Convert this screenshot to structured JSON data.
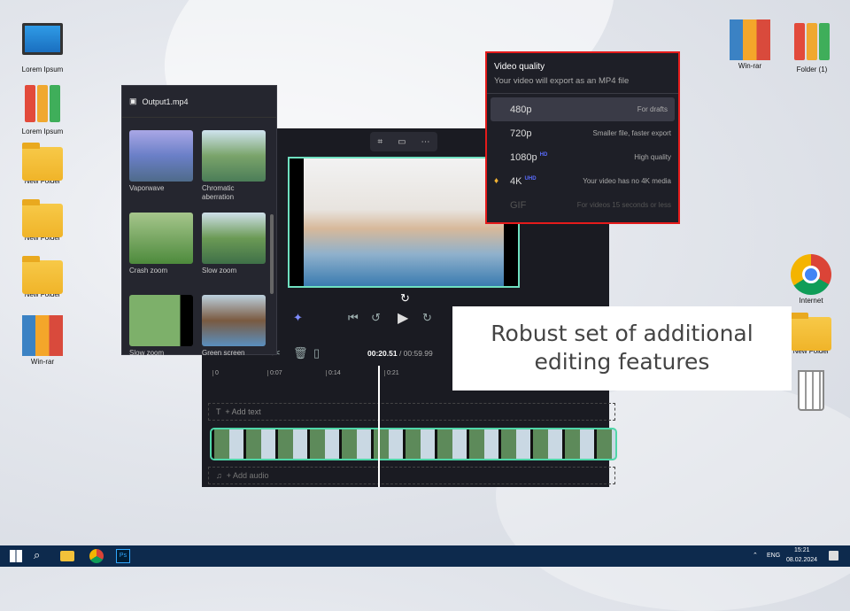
{
  "desktop": {
    "left_icons": [
      "Lorem Ipsum",
      "Lorem Ipsum",
      "New Folder",
      "New Folder",
      "New Folder",
      "Win-rar"
    ],
    "right_icons": [
      "Win-rar",
      "Folder (1)",
      "Internet",
      "New Folder"
    ]
  },
  "effects_panel": {
    "title": "Output1.mp4",
    "items": [
      "Vaporwave",
      "Chromatic aberration",
      "Crash zoom",
      "Slow zoom",
      "Slow zoom",
      "Green screen"
    ]
  },
  "timeline": {
    "current_time": "00:20.51",
    "total_time": "/ 00:59.99",
    "ticks": [
      "0",
      "0:07",
      "0:14",
      "0:21"
    ],
    "add_text": "+ Add text",
    "add_audio": "+ Add audio"
  },
  "quality": {
    "title": "Video quality",
    "subtitle": "Your video will export as an MP4 file",
    "options": [
      {
        "label": "480p",
        "badge": "",
        "desc": "For drafts"
      },
      {
        "label": "720p",
        "badge": "",
        "desc": "Smaller file, faster export"
      },
      {
        "label": "1080p",
        "badge": "HD",
        "desc": "High quality"
      },
      {
        "label": "4K",
        "badge": "UHD",
        "desc": "Your video has no 4K media"
      },
      {
        "label": "GIF",
        "badge": "",
        "desc": "For videos 15 seconds or less"
      }
    ],
    "accent": "#e51b1b"
  },
  "caption": {
    "line1": "Robust set of additional",
    "line2": "editing features"
  },
  "taskbar": {
    "lang": "ENG",
    "time": "15:21",
    "date": "08.02.2024",
    "ps": "Ps"
  }
}
